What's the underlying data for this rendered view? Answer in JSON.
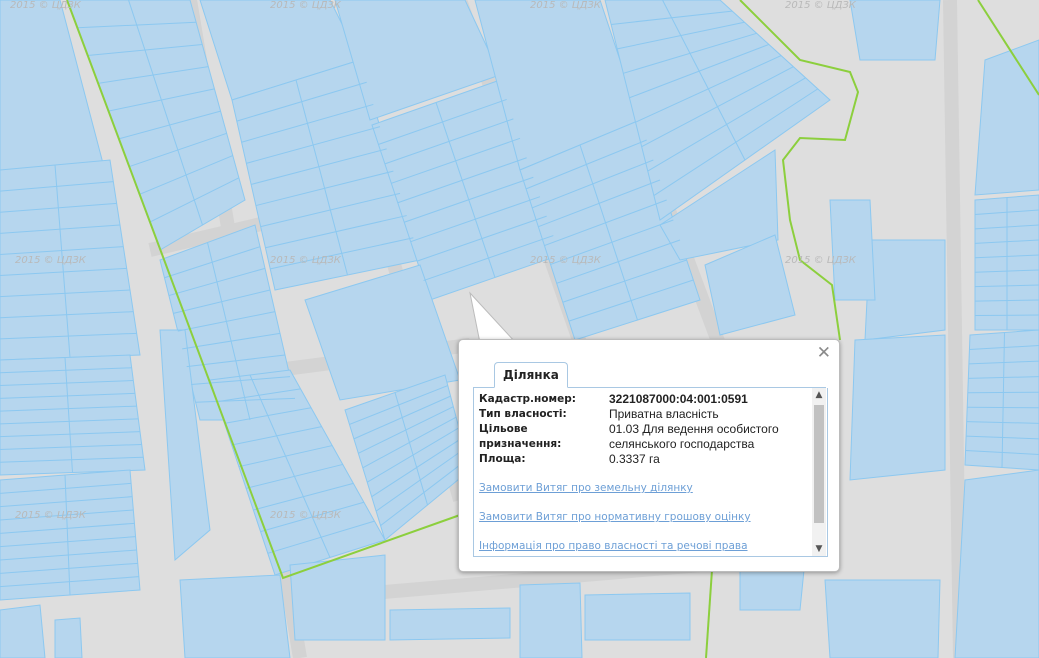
{
  "map": {
    "watermark": "2015 © ЦДЗК",
    "colors": {
      "background": "#dedede",
      "parcel_fill": "#b6d6ee",
      "parcel_stroke": "#8cc8f0",
      "road": "#d5d5d5",
      "boundary": "#8ccf3d"
    }
  },
  "popup": {
    "close_icon": "close-icon",
    "tab_label": "Ділянка",
    "fields": [
      {
        "key": "Кадастр.номер:",
        "value": "3221087000:04:001:0591"
      },
      {
        "key": "Тип власності:",
        "value": "Приватна власність"
      },
      {
        "key": "Цільове призначення:",
        "value": "01.03 Для ведення особистого селянського господарства"
      },
      {
        "key": "Площа:",
        "value": "0.3337 га"
      }
    ],
    "links": [
      "Замовити Витяг про земельну ділянку",
      "Замовити Витяг про нормативну грошову оцінку",
      "Інформація про право власності та речові права"
    ],
    "scroll_up_icon": "chevron-up-icon",
    "scroll_down_icon": "chevron-down-icon"
  }
}
